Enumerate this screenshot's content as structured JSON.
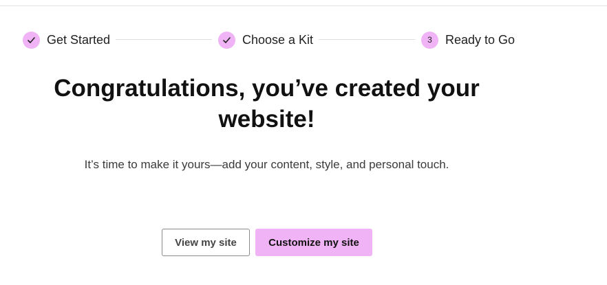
{
  "stepper": {
    "steps": [
      {
        "label": "Get Started",
        "status": "complete",
        "marker": "check-icon"
      },
      {
        "label": "Choose a Kit",
        "status": "complete",
        "marker": "check-icon"
      },
      {
        "label": "Ready to Go",
        "status": "current",
        "number": "3"
      }
    ]
  },
  "main": {
    "headline": "Congratulations, you’ve created your website!",
    "subtext": "It’s time to make it yours—add your content, style, and personal touch."
  },
  "actions": {
    "view_label": "View my site",
    "customize_label": "Customize my site"
  },
  "colors": {
    "accent": "#f0b3f5",
    "text": "#1f1f1f",
    "border": "#8a8a8a"
  }
}
